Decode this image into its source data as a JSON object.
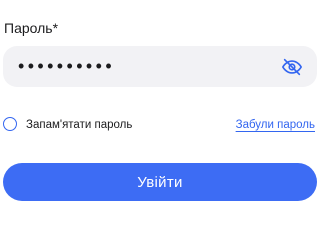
{
  "form": {
    "password_label": "Пароль*",
    "password_value_masked": "••••••••••",
    "password_visibility_icon": "eye-off-icon",
    "remember_label": "Запам'ятати пароль",
    "remember_checked": false,
    "forgot_link": "Забули пароль",
    "submit_label": "Увійти"
  },
  "colors": {
    "accent": "#3d6cf4",
    "link": "#3366f0",
    "input_background": "#f2f2f5",
    "text": "#1c1c1e"
  }
}
